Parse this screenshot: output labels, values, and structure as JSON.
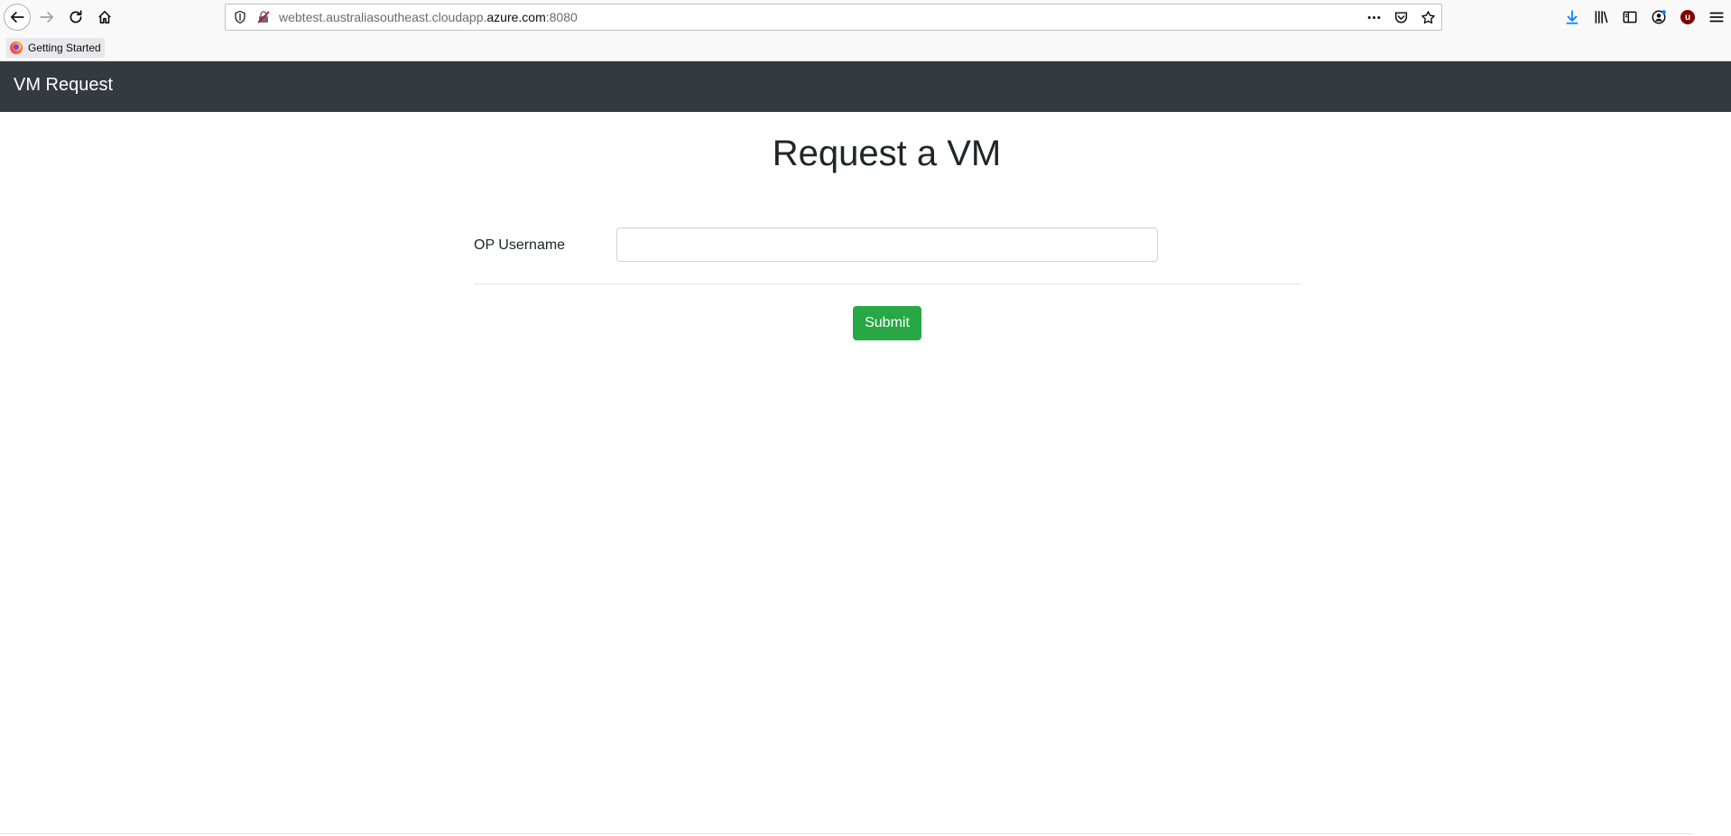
{
  "browser": {
    "url_prefix": "webtest.australiasoutheast.cloudapp.",
    "url_host": "azure.com",
    "url_suffix": ":8080",
    "bookmarks": [
      {
        "label": "Getting Started"
      }
    ],
    "toolbar_icons": [
      "back-icon",
      "forward-icon",
      "reload-icon",
      "home-icon",
      "page-actions-icon",
      "pocket-icon",
      "bookmark-star-icon",
      "download-icon",
      "library-icon",
      "sidebar-icon",
      "account-icon",
      "ublock-icon",
      "menu-icon"
    ],
    "ublock_letter": "u"
  },
  "app": {
    "brand": "VM Request",
    "title": "Request a VM",
    "form": {
      "username_label": "OP Username",
      "username_value": "",
      "submit_label": "Submit"
    }
  },
  "colors": {
    "navbar": "#343a40",
    "submit": "#28a745"
  }
}
